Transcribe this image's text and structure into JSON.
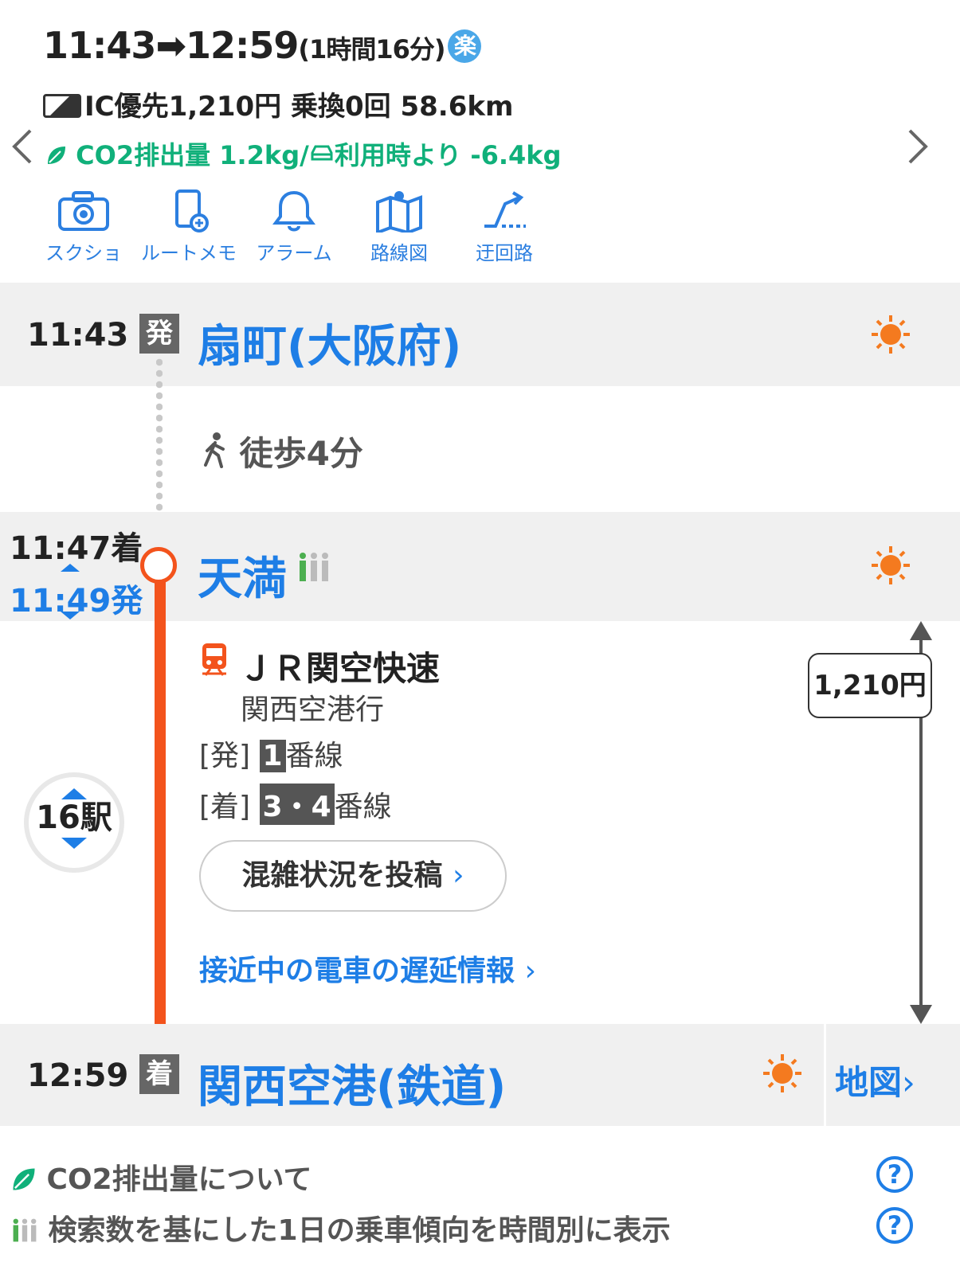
{
  "summary": {
    "depart_time": "11:43",
    "arrow": "➡",
    "arrive_time": "12:59",
    "duration": "(1時間16分)",
    "raku_badge": "楽",
    "fare": "IC優先1,210円 乗換0回 58.6km",
    "co2_text": "CO2排出量 1.2kg",
    "co2_separator": "/",
    "co2_compare": "利用時より -6.4kg"
  },
  "tools": [
    {
      "label": "スクショ",
      "icon": "camera-icon"
    },
    {
      "label": "ルートメモ",
      "icon": "memo-icon"
    },
    {
      "label": "アラーム",
      "icon": "bell-icon"
    },
    {
      "label": "路線図",
      "icon": "map-icon"
    },
    {
      "label": "迂回路",
      "icon": "detour-icon"
    }
  ],
  "route": {
    "origin": {
      "time": "11:43",
      "badge": "発",
      "name": "扇町(大阪府)"
    },
    "walk": "徒歩4分",
    "transfer": {
      "arrive": "11:47着",
      "depart": "11:49発",
      "name": "天満"
    },
    "train": {
      "line": "ＪＲ関空快速",
      "destination": "関西空港行",
      "depart_label": "[発]",
      "depart_platform": "1",
      "platform_suffix": "番線",
      "arrive_label": "[着]",
      "arrive_platform": "3・4",
      "crowd_button": "混雑状況を投稿",
      "delay_link": "接近中の電車の遅延情報",
      "stations": "16駅",
      "fare": "1,210円"
    },
    "destination": {
      "time": "12:59",
      "badge": "着",
      "name": "関西空港(鉄道)",
      "map_link": "地図"
    }
  },
  "footer": {
    "co2_about": "CO2排出量について",
    "crowd_trend": "検索数を基にした1日の乗車傾向を時間別に表示",
    "help": "?"
  },
  "colors": {
    "accent": "#1e7ee6",
    "line": "#f3531c",
    "eco": "#10b07a",
    "sun": "#f47a1f"
  }
}
